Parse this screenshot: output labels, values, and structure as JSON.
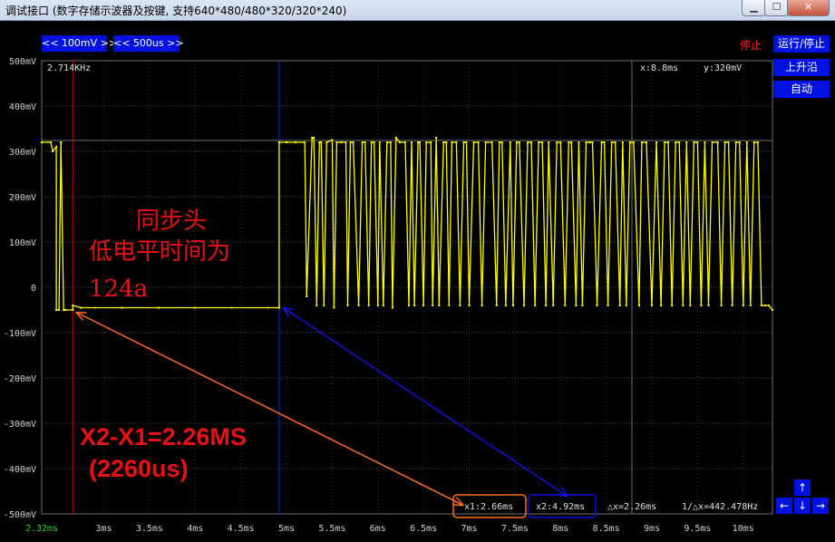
{
  "window": {
    "title": "调试接口 (数字存储示波器及按键, 支持640*480/480*320/320*240)",
    "min_glyph": "▁",
    "max_glyph": "☐",
    "close_glyph": "✕"
  },
  "toolbar": {
    "volt_div": "<< 100mV >>",
    "time_div": "<< 500us >>",
    "status": "停止",
    "run_stop": "运行/停止",
    "edge": "上升沿",
    "mode": "自动"
  },
  "scope": {
    "frequency": "2.714KHz",
    "cursor_x": "x:8.8ms",
    "cursor_y": "y:320mV",
    "x1": "x1:2.66ms",
    "x2": "x2:4.92ms",
    "dx": "△x=2.26ms",
    "inv_dx": "1/△x=442.478Hz",
    "y_ticks": [
      "500mV",
      "400mV",
      "300mV",
      "200mV",
      "100mV",
      "0",
      "-100mV",
      "-200mV",
      "-300mV",
      "-400mV",
      "-500mV"
    ],
    "x_ticks": [
      "2.32ms",
      "3ms",
      "3.5ms",
      "4ms",
      "4.5ms",
      "5ms",
      "5.5ms",
      "6ms",
      "6.5ms",
      "7ms",
      "7.5ms",
      "8ms",
      "8.5ms",
      "9ms",
      "9.5ms",
      "10ms"
    ]
  },
  "annotations": {
    "sync_line1": "同步头",
    "sync_line2": "低电平时间为",
    "sync_line3": "124a",
    "formula": "X2-X1=2.26MS",
    "formula_us": "(2260us)"
  },
  "nav": {
    "up": "↑",
    "down": "↓",
    "left": "←",
    "right": "→"
  },
  "colors": {
    "trace": "#ffff00",
    "cursor1": "#c00000",
    "cursor2": "#0020ff",
    "annotation_red": "#e81010",
    "arrow_orange": "#ff6a1a",
    "arrow_blue": "#1010e0",
    "button_blue": "#0010e0",
    "grid": "#505050"
  },
  "chart_data": {
    "type": "line",
    "xlabel": "",
    "ylabel": "",
    "xlim": [
      2.32,
      10.32
    ],
    "ylim": [
      -500,
      500
    ],
    "grid": true,
    "x_unit": "ms",
    "y_unit": "mV",
    "series": [
      {
        "x": [
          2.32,
          2.42,
          2.44,
          2.48,
          2.48,
          2.51,
          2.53,
          2.53,
          2.56,
          2.58,
          2.66,
          2.66,
          2.75,
          2.9,
          3.2,
          3.6,
          4.0,
          4.4,
          4.8,
          4.92,
          4.92,
          5.0,
          5.1,
          5.2,
          5.22,
          5.28,
          5.3,
          5.33,
          5.36,
          5.38,
          5.41,
          5.44,
          5.5,
          5.52,
          5.55,
          5.6,
          5.65,
          5.67,
          5.7,
          5.73,
          5.79,
          5.83,
          5.86,
          5.9,
          5.93,
          5.96,
          6.0,
          6.02,
          6.06,
          6.1,
          6.14,
          6.16,
          6.2,
          6.24,
          6.3,
          6.34,
          6.37,
          6.4,
          6.44,
          6.46,
          6.5,
          6.53,
          6.58,
          6.6,
          6.64,
          6.67,
          6.72,
          6.75,
          6.78,
          6.81,
          6.86,
          6.9,
          6.94,
          6.97,
          7.0,
          7.05,
          7.1,
          7.14,
          7.18,
          7.25,
          7.3,
          7.33,
          7.36,
          7.4,
          7.45,
          7.48,
          7.52,
          7.55,
          7.6,
          7.64,
          7.68,
          7.72,
          7.76,
          7.8,
          7.84,
          7.87,
          7.92,
          7.96,
          8.0,
          8.05,
          8.09,
          8.12,
          8.17,
          8.2,
          8.24,
          8.28,
          8.32,
          8.35,
          8.4,
          8.45,
          8.48,
          8.52,
          8.56,
          8.6,
          8.65,
          8.68,
          8.72,
          8.76,
          8.8,
          8.86,
          8.89,
          8.94,
          9.0,
          9.05,
          9.1,
          9.14,
          9.18,
          9.22,
          9.26,
          9.3,
          9.34,
          9.38,
          9.42,
          9.46,
          9.5,
          9.54,
          9.58,
          9.62,
          9.66,
          9.72,
          9.76,
          9.8,
          9.84,
          9.88,
          9.92,
          9.96,
          10.0,
          10.04,
          10.08,
          10.12,
          10.16,
          10.2,
          10.24,
          10.28,
          10.32
        ],
        "y": [
          320,
          320,
          300,
          310,
          -50,
          -50,
          320,
          320,
          -50,
          -50,
          -50,
          -40,
          -45,
          -45,
          -45,
          -45,
          -45,
          -45,
          -45,
          -45,
          320,
          320,
          320,
          320,
          -20,
          330,
          330,
          -40,
          320,
          320,
          -40,
          320,
          325,
          -45,
          320,
          320,
          320,
          -40,
          320,
          320,
          -40,
          320,
          320,
          -40,
          320,
          320,
          -40,
          320,
          -40,
          320,
          320,
          -45,
          330,
          320,
          320,
          -40,
          320,
          -40,
          320,
          320,
          -40,
          320,
          320,
          -40,
          330,
          -40,
          320,
          320,
          -40,
          320,
          320,
          -40,
          320,
          320,
          -40,
          320,
          320,
          -40,
          320,
          320,
          -40,
          320,
          320,
          -40,
          320,
          -40,
          320,
          320,
          -40,
          320,
          320,
          -40,
          320,
          320,
          -40,
          320,
          -40,
          320,
          320,
          -40,
          320,
          320,
          -40,
          320,
          -40,
          320,
          320,
          320,
          -40,
          320,
          320,
          -40,
          320,
          320,
          -40,
          320,
          -40,
          320,
          320,
          -40,
          320,
          320,
          -40,
          320,
          -40,
          320,
          320,
          -40,
          320,
          320,
          -40,
          320,
          -40,
          320,
          320,
          -40,
          320,
          -40,
          320,
          320,
          -40,
          320,
          320,
          -40,
          320,
          320,
          -40,
          320,
          -40,
          320,
          320,
          -40,
          -40,
          -40,
          -50
        ]
      }
    ],
    "cursors": {
      "x1_ms": 2.66,
      "x2_ms": 4.92,
      "delta_ms": 2.26
    }
  }
}
